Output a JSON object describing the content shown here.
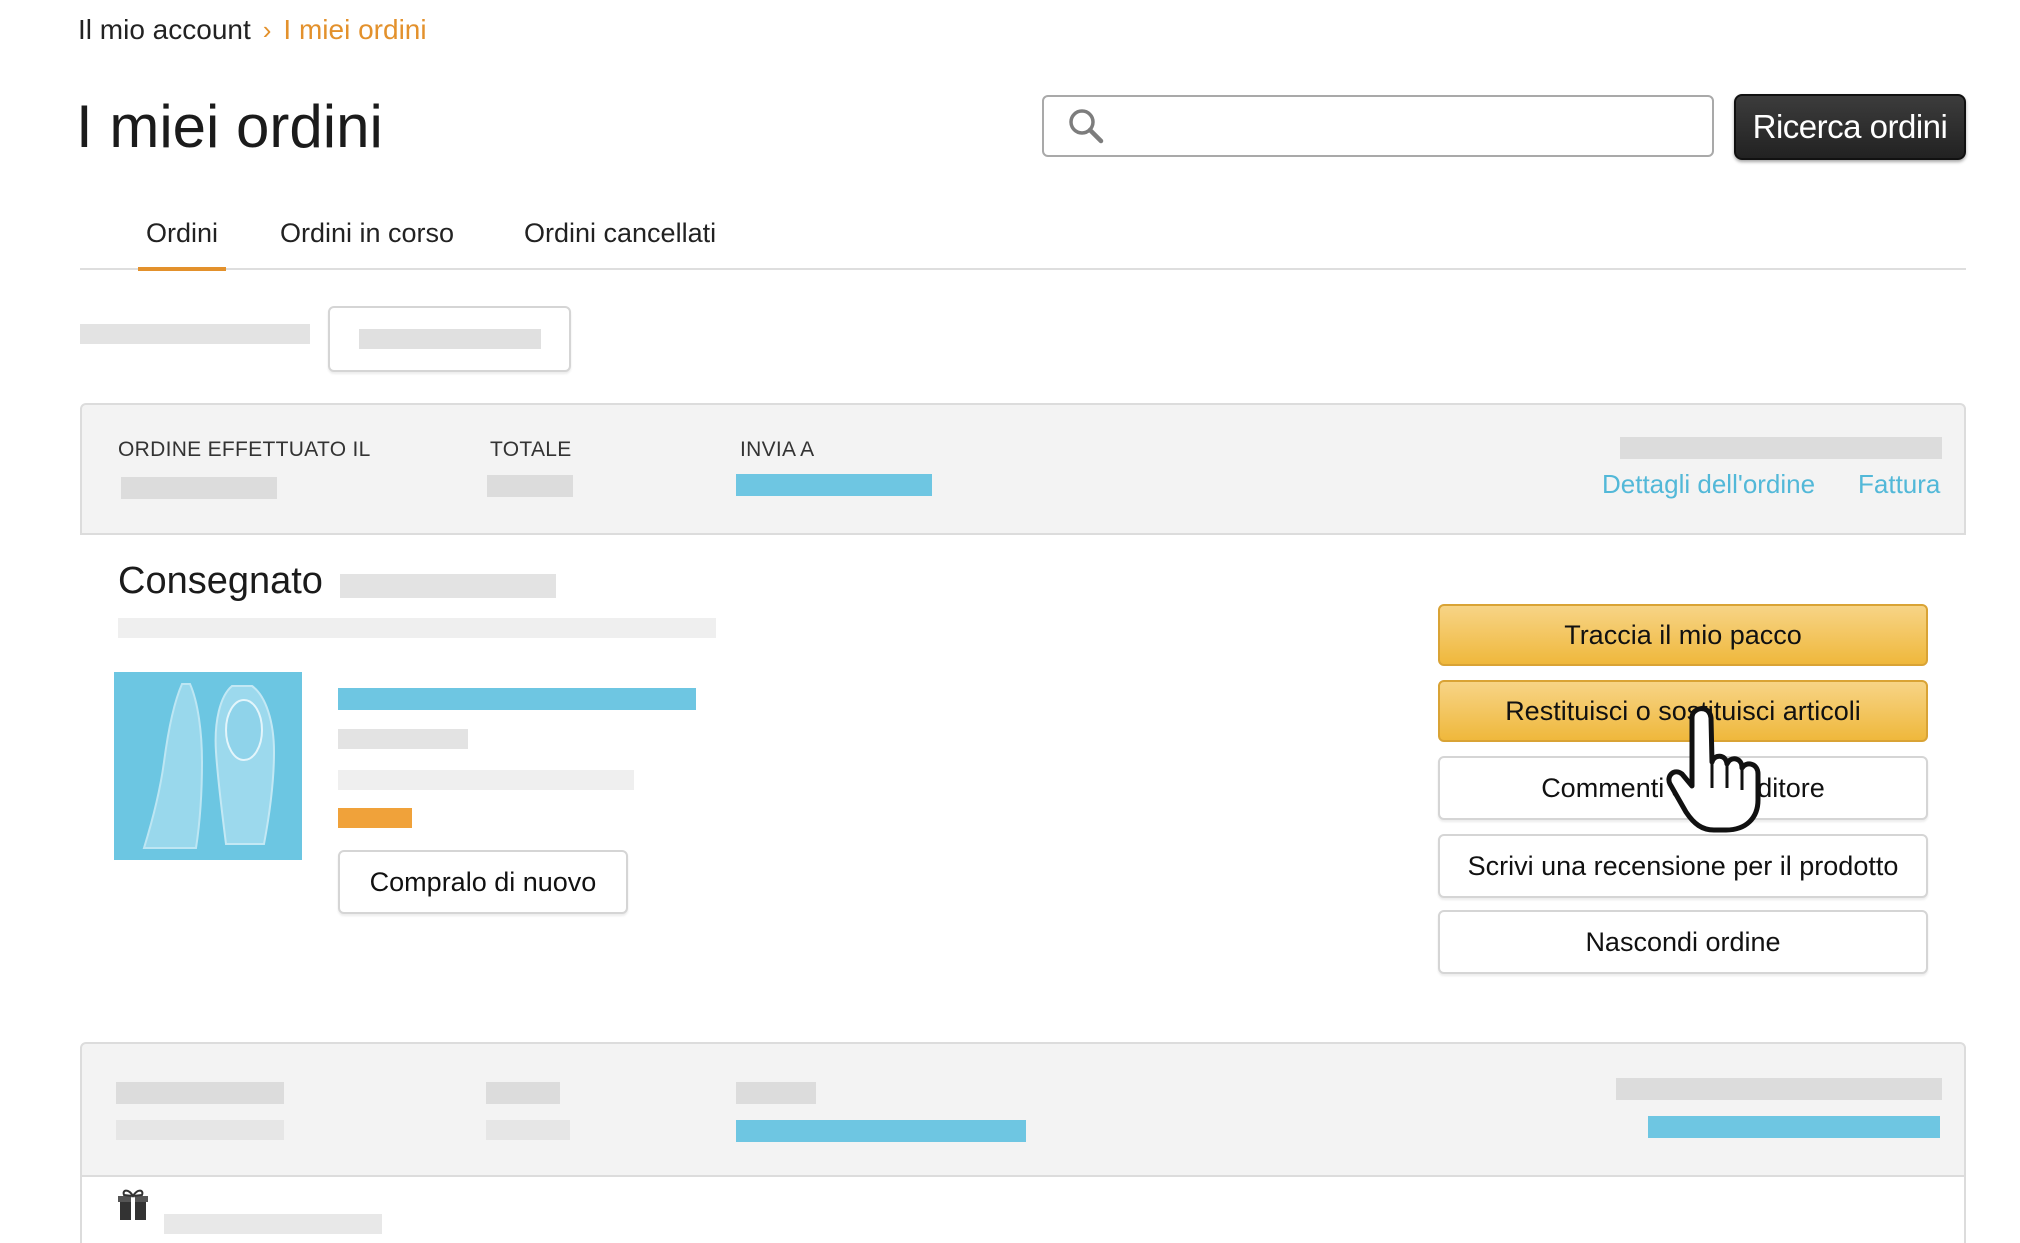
{
  "breadcrumb": {
    "root": "Il mio account",
    "separator": "›",
    "current": "I miei ordini"
  },
  "page": {
    "title": "I miei ordini"
  },
  "search": {
    "placeholder": "",
    "value": "",
    "button_label": "Ricerca ordini"
  },
  "tabs": [
    {
      "label": "Ordini",
      "active": true
    },
    {
      "label": "Ordini in corso",
      "active": false
    },
    {
      "label": "Ordini cancellati",
      "active": false
    }
  ],
  "order": {
    "header": {
      "placed_label": "ORDINE EFFETTUATO IL",
      "total_label": "TOTALE",
      "ship_to_label": "INVIA A",
      "details_link": "Dettagli dell'ordine",
      "invoice_link": "Fattura"
    },
    "status": "Consegnato",
    "buy_again_label": "Compralo di nuovo",
    "actions": [
      {
        "label": "Traccia il mio pacco",
        "style": "primary"
      },
      {
        "label": "Restituisci o sostituisci articoli",
        "style": "primary"
      },
      {
        "label": "Commenti sul venditore",
        "style": "secondary"
      },
      {
        "label": "Scrivi una recensione per il prodotto",
        "style": "secondary"
      },
      {
        "label": "Nascondi ordine",
        "style": "secondary"
      }
    ]
  },
  "icons": {
    "search": "search-icon",
    "cursor": "hand-pointer-icon",
    "gift": "gift-icon",
    "product": "shoe-image"
  },
  "colors": {
    "accent_orange": "#e3912c",
    "link_blue": "#52b8d8",
    "button_yellow": "#efb83c",
    "dark_button": "#2b2b2b"
  }
}
